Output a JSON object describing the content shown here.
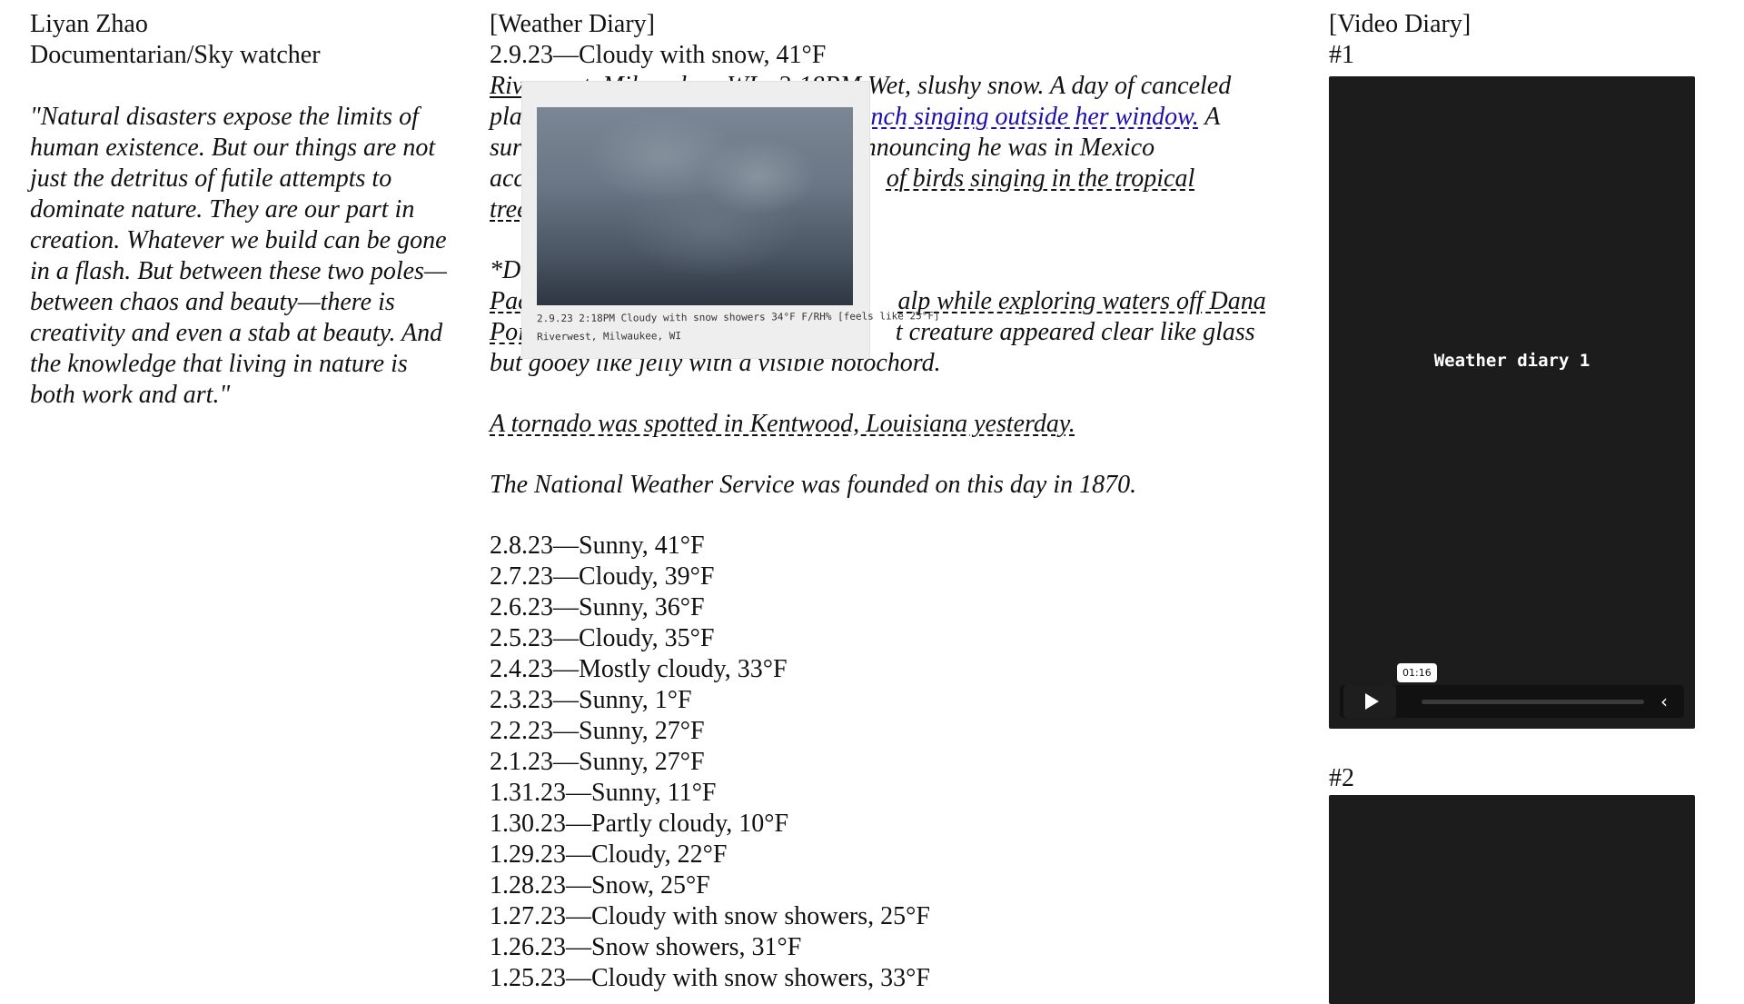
{
  "profile": {
    "name": "Liyan Zhao",
    "role": "Documentarian/Sky watcher",
    "quote_lines": [
      "\"Natural disasters expose the limits of",
      "human existence. But our things are not",
      "just the detritus of futile attempts to",
      "dominate nature. They are our part in",
      "creation. Whatever we build can be gone",
      "in a flash. But between these two poles—",
      "between chaos and beauty—there is",
      "creativity and even a stab at beauty. And",
      "the knowledge that living in nature is",
      "both work and art.\""
    ]
  },
  "weather_diary": {
    "heading": "[Weather Diary]",
    "current_entry": "2.9.23—Cloudy with snow, 41°F",
    "story": {
      "l1_visible_start": "Riv",
      "l1_hidden": "erwest, Milwaukee, WI - 2:18PM",
      "l1_rest": " Wet, slushy snow. A day of canceled",
      "l2_start": "pla",
      "l2_link": "inch singing outside her window.",
      "l2_end": " A",
      "l3_start": "sur",
      "l3_rest": "nnouncing he was in Mexico",
      "l4_start": "acc",
      "l4_link": "of birds singing in the tropical",
      "l5_start": "tree",
      "l6_start": "*D",
      "l7_start": "Pac",
      "l7_link": "alp while exploring waters off Dana",
      "l8_start": "Poi",
      "l8_rest": "t creature appeared clear like glass",
      "l9": "but gooey like jelly with a visible notochord."
    },
    "tornado_note": "A tornado was spotted in Kentwood, Louisiana yesterday.",
    "nws_note": "The National Weather Service was founded on this day in 1870.",
    "entries": [
      "2.8.23—Sunny, 41°F",
      "2.7.23—Cloudy, 39°F",
      "2.6.23—Sunny, 36°F",
      "2.5.23—Cloudy, 35°F",
      "2.4.23—Mostly cloudy, 33°F",
      "2.3.23—Sunny, 1°F",
      "2.2.23—Sunny, 27°F",
      "2.1.23—Sunny, 27°F",
      "1.31.23—Sunny, 11°F",
      "1.30.23—Partly cloudy, 10°F",
      "1.29.23—Cloudy, 22°F",
      "1.28.23—Snow, 25°F",
      "1.27.23—Cloudy with snow showers, 25°F",
      "1.26.23—Snow showers, 31°F",
      "1.25.23—Cloudy with snow showers, 33°F"
    ],
    "photo_popup": {
      "caption_line1": "2.9.23  2:18PM  Cloudy with snow showers 34°F F/RH% [feels like 25°F]",
      "caption_line2": "Riverwest, Milwaukee, WI"
    }
  },
  "video_diary": {
    "heading": "[Video Diary]",
    "video1": {
      "label": "#1",
      "title": "Weather diary 1",
      "time_tooltip": "01:16",
      "progress": 0
    },
    "video2": {
      "label": "#2"
    }
  },
  "icons": {
    "play": "play-icon",
    "collapse": "chevron-left-icon"
  },
  "colors": {
    "link": "#1a0dab",
    "video_bg": "#1c1c1c"
  }
}
